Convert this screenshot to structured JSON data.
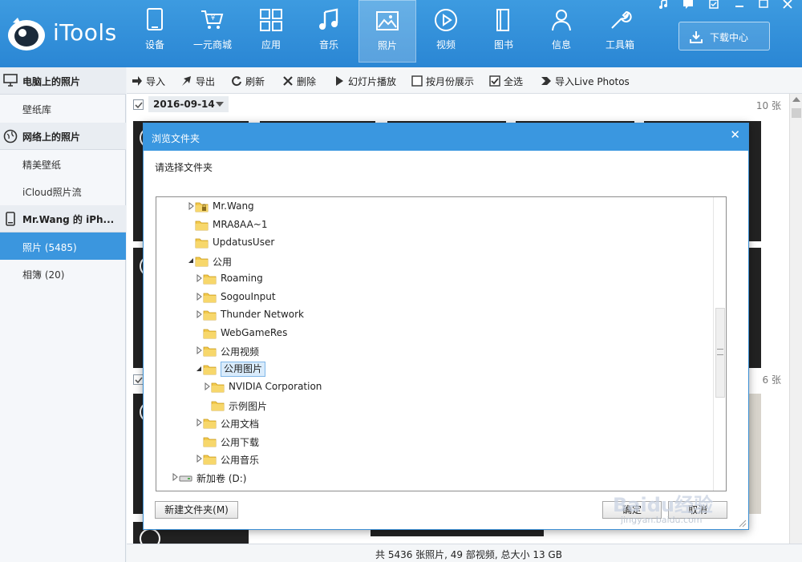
{
  "app": {
    "title": "iTools"
  },
  "nav": {
    "tabs": [
      {
        "label": "设备",
        "icon": "device-icon"
      },
      {
        "label": "一元商城",
        "icon": "cart-icon"
      },
      {
        "label": "应用",
        "icon": "apps-icon"
      },
      {
        "label": "音乐",
        "icon": "music-icon"
      },
      {
        "label": "照片",
        "icon": "photo-icon",
        "active": true
      },
      {
        "label": "视频",
        "icon": "video-icon"
      },
      {
        "label": "图书",
        "icon": "book-icon"
      },
      {
        "label": "信息",
        "icon": "contact-icon"
      },
      {
        "label": "工具箱",
        "icon": "toolbox-icon"
      }
    ],
    "download_center": "下载中心"
  },
  "sidebar": {
    "pc_photos": "电脑上的照片",
    "wallpaper_lib": "壁纸库",
    "online_photos": "网络上的照片",
    "featured_wallpaper": "精美壁纸",
    "icloud_stream": "iCloud照片流",
    "device_name": "Mr.Wang 的 iPh...",
    "photos": "照片 (5485)",
    "albums": "相簿 (20)"
  },
  "toolbar": {
    "import": "导入",
    "export": "导出",
    "refresh": "刷新",
    "delete": "删除",
    "slideshow": "幻灯片播放",
    "by_month": "按月份展示",
    "select_all": "全选",
    "import_live": "导入Live Photos"
  },
  "groups": [
    {
      "date": "2016-09-14",
      "count": "10 张"
    },
    {
      "count": "6 张"
    }
  ],
  "status": {
    "summary": "共 5436 张照片, 49 部视频, 总大小 13 GB"
  },
  "dialog": {
    "title": "浏览文件夹",
    "prompt": "请选择文件夹",
    "tree": [
      {
        "label": "Mr.Wang",
        "level": 0,
        "arrow": "collapsed",
        "locked": true
      },
      {
        "label": "MRA8AA~1",
        "level": 0,
        "arrow": "none"
      },
      {
        "label": "UpdatusUser",
        "level": 0,
        "arrow": "none"
      },
      {
        "label": "公用",
        "level": 0,
        "arrow": "expanded"
      },
      {
        "label": "Roaming",
        "level": 1,
        "arrow": "collapsed"
      },
      {
        "label": "SogouInput",
        "level": 1,
        "arrow": "collapsed"
      },
      {
        "label": "Thunder Network",
        "level": 1,
        "arrow": "collapsed"
      },
      {
        "label": "WebGameRes",
        "level": 1,
        "arrow": "none"
      },
      {
        "label": "公用视频",
        "level": 1,
        "arrow": "collapsed"
      },
      {
        "label": "公用图片",
        "level": 1,
        "arrow": "expanded",
        "selected": true
      },
      {
        "label": "NVIDIA Corporation",
        "level": 2,
        "arrow": "collapsed"
      },
      {
        "label": "示例图片",
        "level": 2,
        "arrow": "none"
      },
      {
        "label": "公用文档",
        "level": 1,
        "arrow": "collapsed"
      },
      {
        "label": "公用下载",
        "level": 1,
        "arrow": "none"
      },
      {
        "label": "公用音乐",
        "level": 1,
        "arrow": "collapsed"
      },
      {
        "label": "新加卷 (D:)",
        "level": -1,
        "arrow": "collapsed",
        "drive": true
      }
    ],
    "new_folder": "新建文件夹(M)",
    "ok": "确定",
    "cancel": "取消"
  },
  "watermark": {
    "brand": "Baidu经验",
    "url": "jingyan.baidu.com"
  }
}
